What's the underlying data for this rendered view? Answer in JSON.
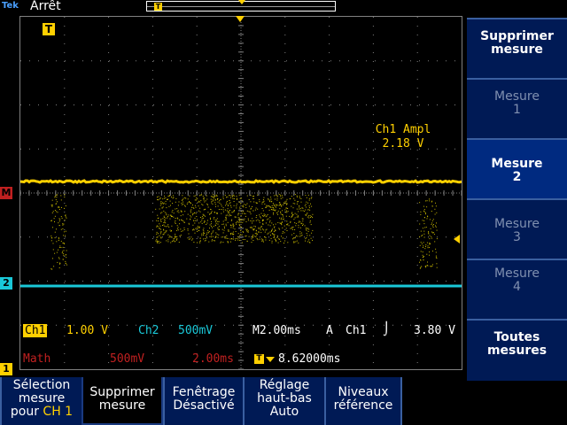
{
  "top": {
    "brand": "Tek",
    "state": "Arrêt"
  },
  "markers": {
    "trigger": "T",
    "math": "M",
    "ch2": "2",
    "ch1": "1"
  },
  "measurement": {
    "label": "Ch1 Ampl",
    "value": "2.18 V"
  },
  "status": {
    "ch1_label": "Ch1",
    "ch1_scale": "1.00 V",
    "ch2_label": "Ch2",
    "ch2_scale": "500mV",
    "timebase": "M2.00ms",
    "trig_mode": "A",
    "trig_source": "Ch1",
    "trig_slope": "⌡",
    "trig_level": "3.80 V",
    "math_label": "Math",
    "math_scale": "500mV",
    "math_time": "2.00ms",
    "trig_pos_value": "8.62000ms"
  },
  "side_menu": [
    {
      "l1": "Supprimer",
      "l2": "mesure",
      "state": "normal"
    },
    {
      "l1": "Mesure",
      "l2": "1",
      "state": "dim"
    },
    {
      "l1": "Mesure",
      "l2": "2",
      "state": "active"
    },
    {
      "l1": "Mesure",
      "l2": "3",
      "state": "dim"
    },
    {
      "l1": "Mesure",
      "l2": "4",
      "state": "dim"
    },
    {
      "l1": "Toutes",
      "l2": "mesures",
      "state": "normal"
    }
  ],
  "bottom_menu": [
    {
      "l1": "Sélection",
      "l2": "mesure",
      "l3a": "pour ",
      "l3b": "CH 1"
    },
    {
      "l1": "Supprimer",
      "l2": "mesure"
    },
    {
      "l1": "Fenêtrage",
      "l2": "Désactivé"
    },
    {
      "l1": "Réglage",
      "l2": "haut-bas",
      "l3": "Auto"
    },
    {
      "l1": "Niveaux",
      "l2": "référence"
    }
  ],
  "colors": {
    "ch1": "#ffd000",
    "ch2": "#1ac8d8",
    "math": "#c02020",
    "menu_bg": "#001a55"
  }
}
